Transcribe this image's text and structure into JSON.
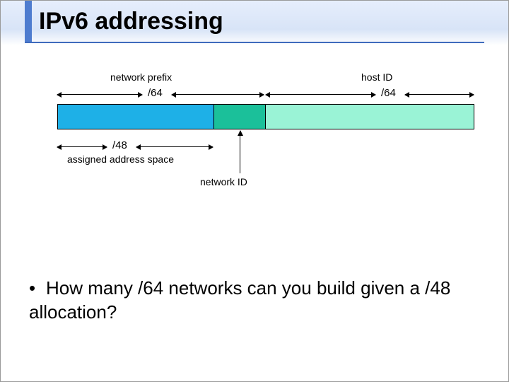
{
  "title": "IPv6 addressing",
  "diagram": {
    "top_labels": {
      "network_prefix": "network prefix",
      "host_id": "host ID"
    },
    "prefixes": {
      "net64": "/64",
      "host64": "/64",
      "p48": "/48"
    },
    "bottom_labels": {
      "assigned": "assigned address space",
      "network_id": "network ID"
    }
  },
  "bullet": "How many /64 networks can you build given a /48 allocation?"
}
